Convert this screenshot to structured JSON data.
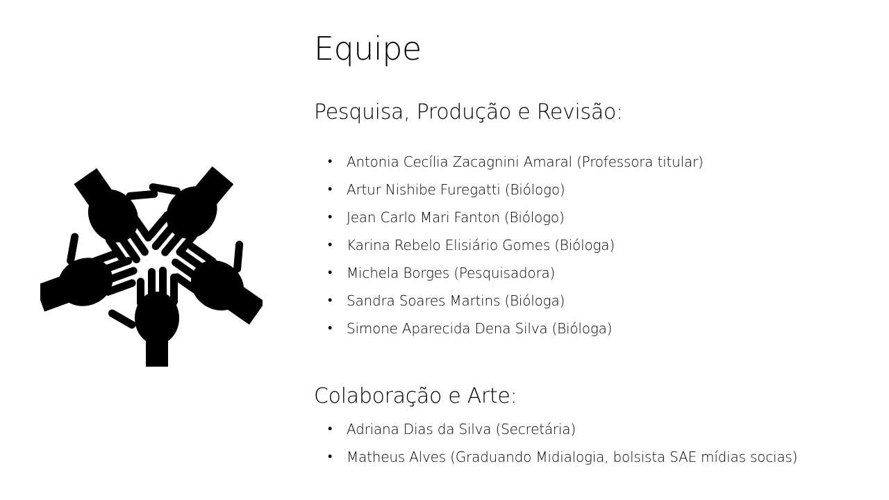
{
  "slide": {
    "title": "Equipe",
    "icon": "hands-together-icon",
    "research_section": {
      "heading": "Pesquisa, Produção e Revisão:",
      "members": [
        "Antonia Cecília Zacagnini Amaral (Professora titular)",
        "Artur Nishibe Furegatti (Biólogo)",
        "Jean Carlo Mari Fanton (Biólogo)",
        "Karina Rebelo Elisiário Gomes (Bióloga)",
        "Michela Borges (Pesquisadora)",
        "Sandra Soares Martins (Bióloga)",
        "Simone Aparecida Dena Silva (Bióloga)"
      ]
    },
    "collab_section": {
      "heading": "Colaboração e Arte:",
      "members": [
        "Adriana Dias da Silva (Secretária)",
        "Matheus Alves (Graduando Midialogia, bolsista SAE mídias socias)"
      ]
    },
    "bullet": "•"
  }
}
